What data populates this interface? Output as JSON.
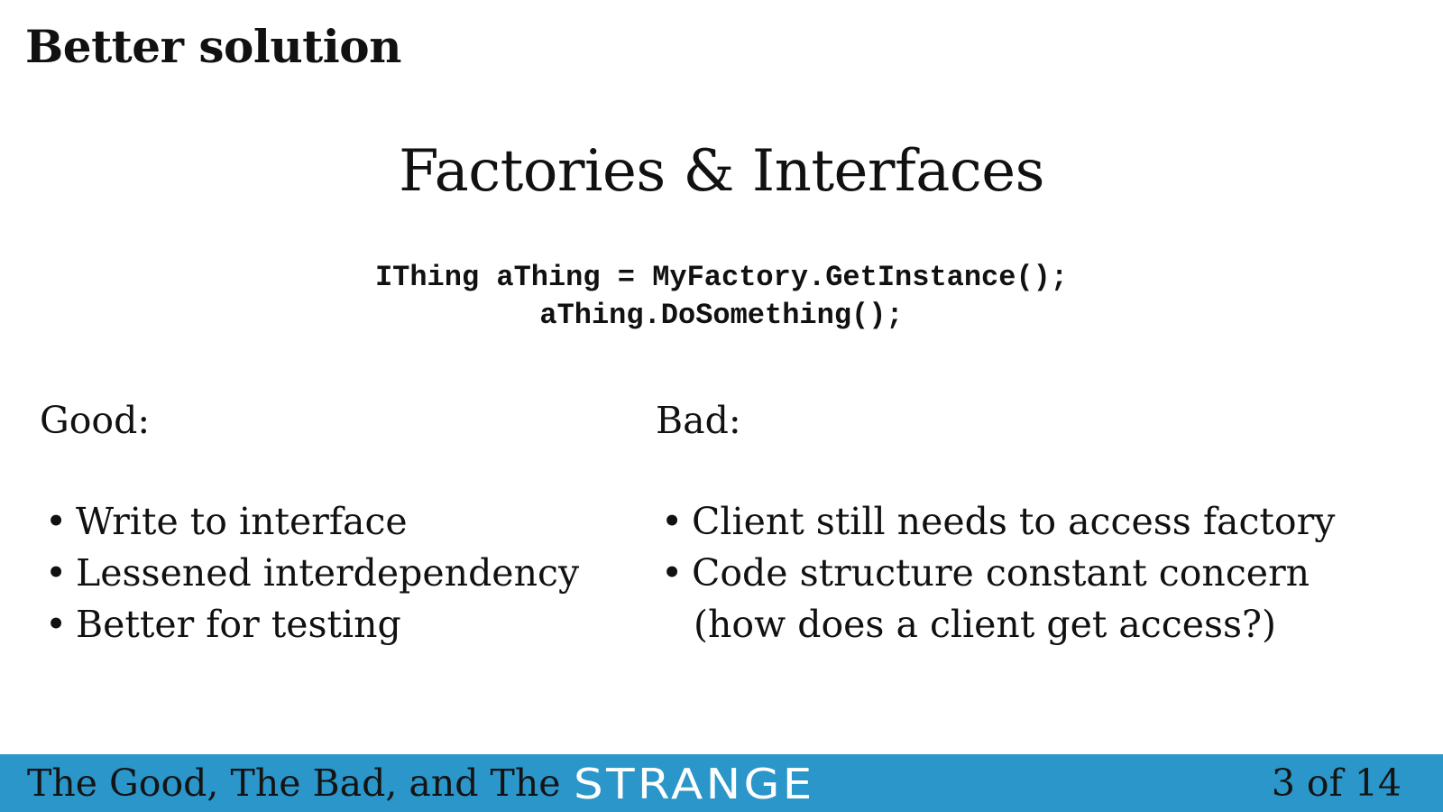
{
  "heading": "Better solution",
  "title": "Factories & Interfaces",
  "code": {
    "lines": [
      "IThing aThing = MyFactory.GetInstance();",
      "aThing.DoSomething();"
    ]
  },
  "good": {
    "label": "Good:",
    "items": [
      "Write to interface",
      "Lessened interdependency",
      "Better for testing"
    ]
  },
  "bad": {
    "label": "Bad:",
    "items": [
      "Client still needs to access factory",
      "Code structure constant concern"
    ],
    "continuation": "(how does a client get access?)"
  },
  "footer": {
    "text": "The Good, The Bad, and The",
    "logo": "STRANGE",
    "page": "3 of 14",
    "background_color": "#2b96c9",
    "logo_color": "#ffffff"
  },
  "bullet_glyph": "•"
}
